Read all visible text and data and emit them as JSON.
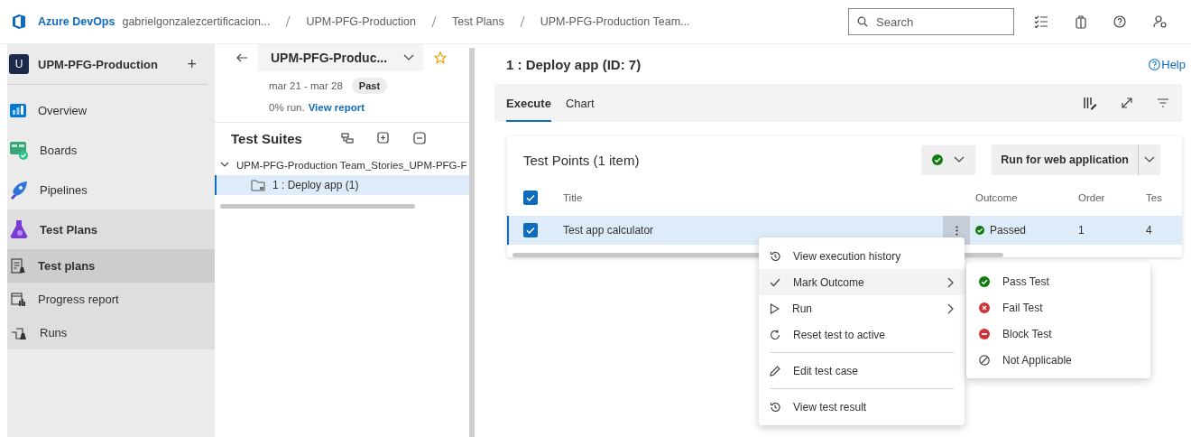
{
  "header": {
    "brand": "Azure DevOps",
    "breadcrumbs": [
      "gabrielgonzalezcertificacion...",
      "UPM-PFG-Production",
      "Test Plans",
      "UPM-PFG-Production Team..."
    ],
    "search": {
      "placeholder": "Search"
    }
  },
  "sidebar": {
    "project": {
      "initial": "U",
      "name": "UPM-PFG-Production",
      "add": "+"
    },
    "items": [
      {
        "label": "Overview",
        "selected": false
      },
      {
        "label": "Boards",
        "selected": false
      },
      {
        "label": "Pipelines",
        "selected": false
      },
      {
        "label": "Test Plans",
        "selected": false,
        "expanded": true,
        "children": [
          {
            "label": "Test plans",
            "selected": true
          },
          {
            "label": "Progress report",
            "selected": false
          },
          {
            "label": "Runs",
            "selected": false
          }
        ]
      }
    ]
  },
  "plan": {
    "title": "UPM-PFG-Produc...",
    "favorite": false,
    "dates": "mar 21 - mar 28",
    "badge": "Past",
    "progress": "0% run.",
    "report_link": "View report"
  },
  "suites": {
    "title": "Test Suites",
    "tree": [
      {
        "label": "UPM-PFG-Production Team_Stories_UPM-PFG-F",
        "expanded": true,
        "selected": false,
        "children": [
          {
            "label": "1 : Deploy app (1)",
            "selected": true
          }
        ]
      }
    ]
  },
  "pane": {
    "title": "1 : Deploy app (ID: 7)",
    "help": "Help",
    "tabs": [
      {
        "label": "Execute",
        "selected": true
      },
      {
        "label": "Chart",
        "selected": false
      }
    ]
  },
  "test_points": {
    "title": "Test Points (1 item)",
    "run_button": "Run for web application",
    "all_checked": true,
    "columns": [
      "Title",
      "Outcome",
      "Order",
      "Tes"
    ],
    "rows": [
      {
        "title": "Test app calculator",
        "outcome": "Passed",
        "color": "#107c10",
        "order": "1",
        "column_4": "4",
        "checked": true,
        "selected": true
      }
    ]
  },
  "context_menu": {
    "sections": [
      [
        {
          "label": "View execution history",
          "submenu": false,
          "selected": false
        },
        {
          "label": "Mark Outcome",
          "submenu": true,
          "selected": true
        },
        {
          "label": "Run",
          "submenu": true,
          "selected": false
        },
        {
          "label": "Reset test to active",
          "submenu": false,
          "selected": false
        }
      ],
      [
        {
          "label": "Edit test case",
          "submenu": false,
          "selected": false
        }
      ],
      [
        {
          "label": "View test result",
          "submenu": false,
          "selected": false
        }
      ]
    ]
  },
  "outcome_menu": {
    "items": [
      {
        "label": "Pass Test",
        "kind": "pass"
      },
      {
        "label": "Fail Test",
        "kind": "fail"
      },
      {
        "label": "Block Test",
        "kind": "block"
      },
      {
        "label": "Not Applicable",
        "kind": "na"
      }
    ]
  }
}
